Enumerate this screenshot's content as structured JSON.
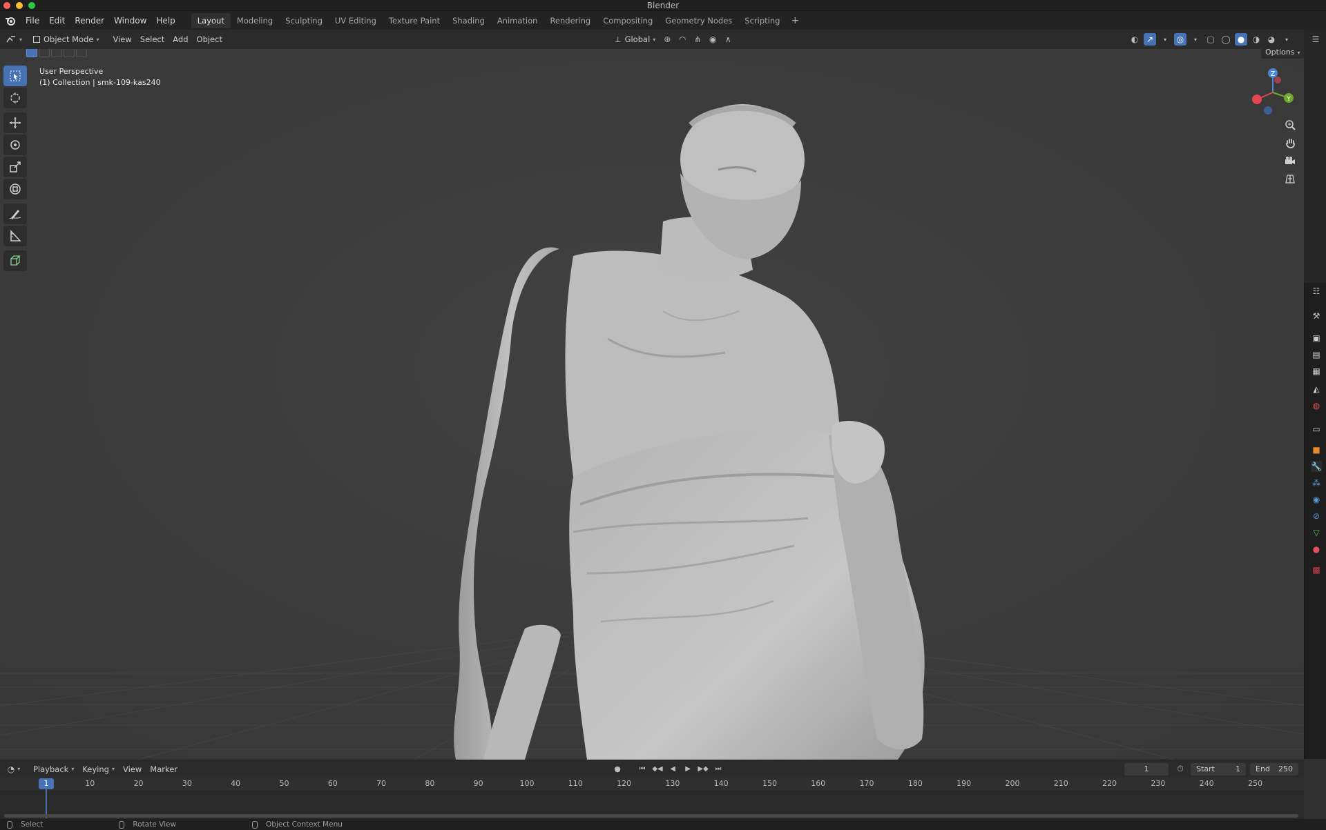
{
  "window": {
    "title": "Blender"
  },
  "menus": [
    "File",
    "Edit",
    "Render",
    "Window",
    "Help"
  ],
  "workspaces": {
    "active": "Layout",
    "tabs": [
      "Layout",
      "Modeling",
      "Sculpting",
      "UV Editing",
      "Texture Paint",
      "Shading",
      "Animation",
      "Rendering",
      "Compositing",
      "Geometry Nodes",
      "Scripting"
    ]
  },
  "viewport_header": {
    "mode": "Object Mode",
    "menus": [
      "View",
      "Select",
      "Add",
      "Object"
    ],
    "orientation": "Global",
    "options_label": "Options"
  },
  "viewport": {
    "perspective_label": "User Perspective",
    "collection_label": "(1) Collection | smk-109-kas240",
    "gizmo_axes": {
      "x": "X",
      "y": "Y",
      "z": "Z"
    },
    "colors": {
      "x_axis": "#e5454f",
      "y_axis": "#6ea62e",
      "z_axis": "#4a86d6",
      "active": "#4772b3"
    }
  },
  "toolbar": {
    "tools": [
      "select-box-icon",
      "cursor-icon",
      "move-icon",
      "rotate-icon",
      "scale-icon",
      "transform-icon",
      "annotate-icon",
      "measure-icon",
      "add-cube-icon"
    ],
    "active_tool": "select-box-icon"
  },
  "timeline": {
    "menus": [
      "Playback",
      "Keying",
      "View",
      "Marker"
    ],
    "current_frame": "1",
    "start_label": "Start",
    "start": "1",
    "end_label": "End",
    "end": "250",
    "ruler_ticks": [
      "10",
      "20",
      "30",
      "40",
      "50",
      "60",
      "70",
      "80",
      "90",
      "100",
      "110",
      "120",
      "130",
      "140",
      "150",
      "160",
      "170",
      "180",
      "190",
      "200",
      "210",
      "220",
      "230",
      "240",
      "250"
    ]
  },
  "statusbar": {
    "items": [
      "Select",
      "Rotate View",
      "Object Context Menu"
    ]
  }
}
